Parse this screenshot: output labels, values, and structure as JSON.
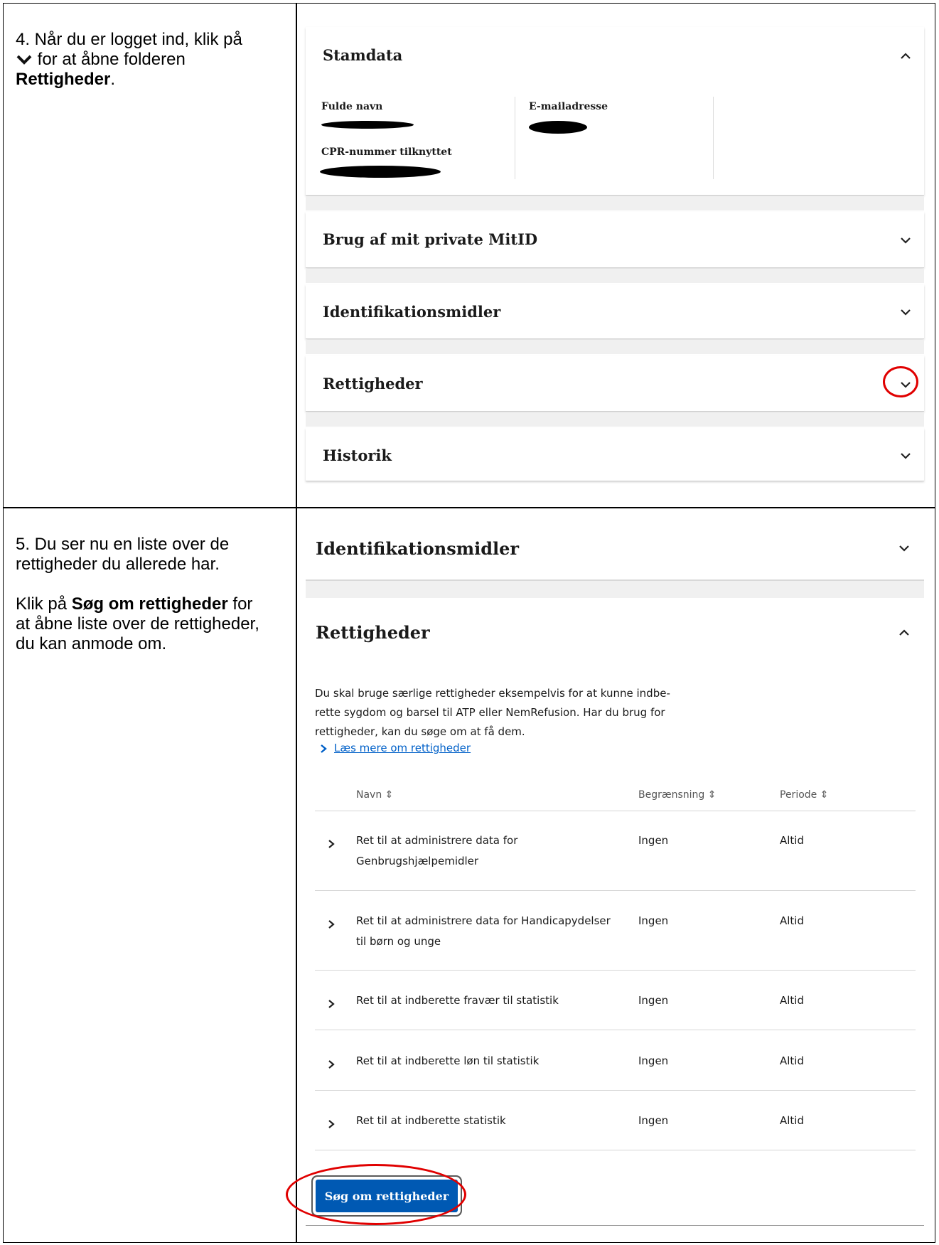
{
  "step4": {
    "line1": "4. Når du er logget ind, klik på",
    "line2": " for at åbne folderen",
    "bold": "Rettigheder",
    "end": "."
  },
  "step5": {
    "line1": "5. Du ser nu en liste over de",
    "line2": "rettigheder du allerede har.",
    "p2_line1_pre": "Klik på ",
    "p2_line1_bold": "Søg om rettigheder",
    "p2_line1_post": " for",
    "p2_line2": "at åbne liste over de rettigheder,",
    "p2_line3": "du kan anmode om."
  },
  "top_panels": {
    "stamdata": {
      "title": "Stamdata",
      "full_name_label": "Fulde navn",
      "email_label": "E-mailadresse",
      "cpr_label": "CPR-nummer tilknyttet"
    },
    "brug": {
      "title": "Brug af mit private MitID"
    },
    "ident": {
      "title": "Identifikationsmidler"
    },
    "rettigheder": {
      "title": "Rettigheder"
    },
    "historik": {
      "title": "Historik"
    }
  },
  "bottom": {
    "ident_title": "Identifikationsmidler",
    "rettigheder_title": "Rettigheder",
    "description_lines": [
      "Du skal bruge særlige rettigheder eksempelvis for at kunne indbe-",
      "rette sygdom og barsel til ATP eller NemRefusion. Har du brug for",
      "rettigheder, kan du søge om at få dem."
    ],
    "read_more_link": "Læs mere om rettigheder",
    "table": {
      "headers": [
        "Navn",
        "Begrænsning",
        "Periode"
      ],
      "rows": [
        {
          "name_line1": "Ret til at administrere data for",
          "name_line2": "Genbrugshjælpemidler",
          "limit": "Ingen",
          "period": "Altid"
        },
        {
          "name_line1": "Ret til at administrere data for Handicapydelser",
          "name_line2": "til børn og unge",
          "limit": "Ingen",
          "period": "Altid"
        },
        {
          "name_line1": "Ret til at indberette fravær til statistik",
          "name_line2": "",
          "limit": "Ingen",
          "period": "Altid"
        },
        {
          "name_line1": "Ret til at indberette løn til statistik",
          "name_line2": "",
          "limit": "Ingen",
          "period": "Altid"
        },
        {
          "name_line1": "Ret til at indberette statistik",
          "name_line2": "",
          "limit": "Ingen",
          "period": "Altid"
        }
      ]
    },
    "apply_button": "Søg om rettigheder"
  },
  "colors": {
    "accent_blue": "#0059b3",
    "link_blue": "#0060c8",
    "highlight_red": "#e00000"
  }
}
